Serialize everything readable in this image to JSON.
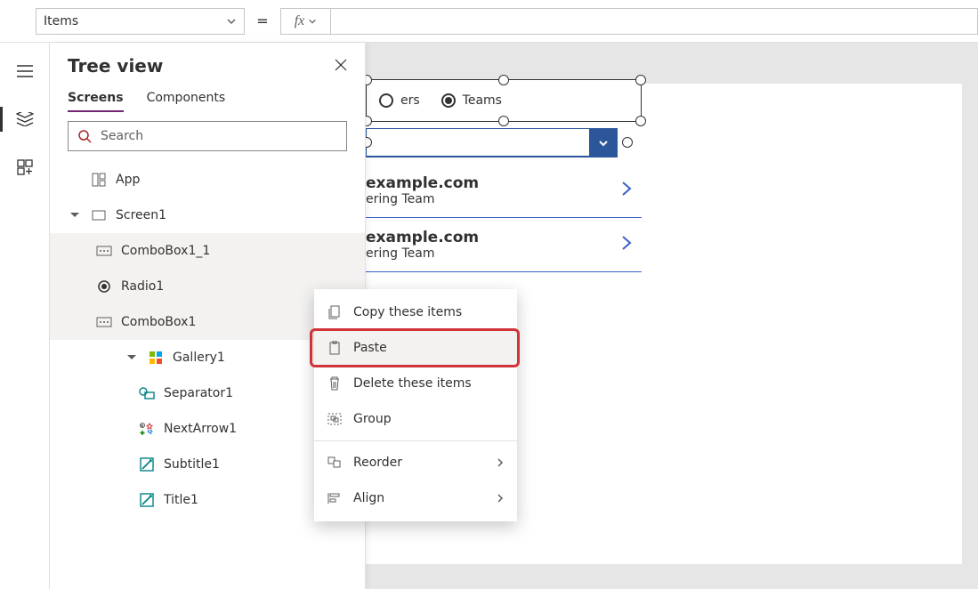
{
  "formula": {
    "property": "Items"
  },
  "panel": {
    "title": "Tree view",
    "tabs": {
      "screens": "Screens",
      "components": "Components"
    },
    "search_placeholder": "Search"
  },
  "tree": {
    "app": "App",
    "screen1": "Screen1",
    "combobox1_1": "ComboBox1_1",
    "radio1": "Radio1",
    "combobox1": "ComboBox1",
    "gallery1": "Gallery1",
    "separator1": "Separator1",
    "nextarrow1": "NextArrow1",
    "subtitle1": "Subtitle1",
    "title1": "Title1"
  },
  "radio": {
    "opt1": "ers",
    "opt2": "Teams"
  },
  "gallery_items": [
    {
      "title": "example.com",
      "sub": "ering Team"
    },
    {
      "title": "example.com",
      "sub": "ering Team"
    }
  ],
  "menu": {
    "copy": "Copy these items",
    "paste": "Paste",
    "delete": "Delete these items",
    "group": "Group",
    "reorder": "Reorder",
    "align": "Align"
  }
}
